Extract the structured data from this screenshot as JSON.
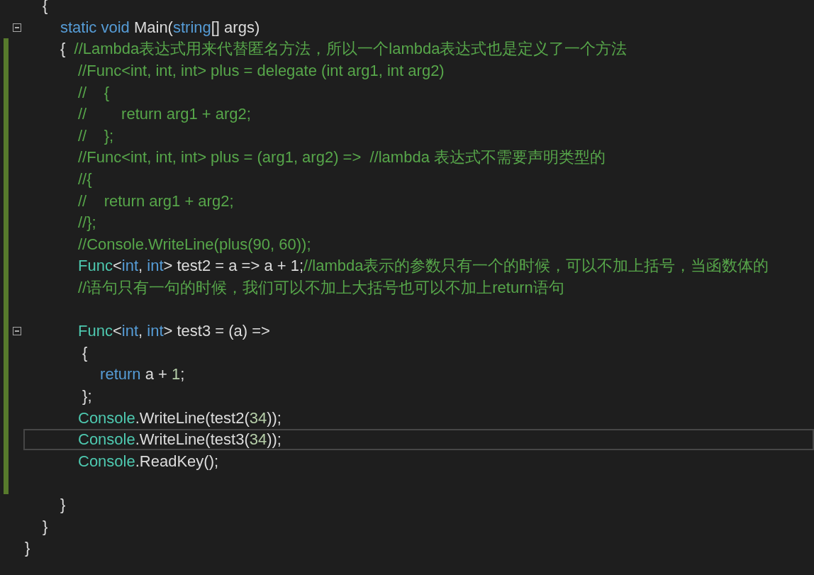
{
  "editor": {
    "lines": [
      {
        "changed": false,
        "tokens": [
          {
            "kind": "plain",
            "text": "\t{"
          }
        ]
      },
      {
        "changed": false,
        "expanded": true,
        "tokens": [
          {
            "kind": "keyword",
            "text": "\t\tstatic void "
          },
          {
            "kind": "plain",
            "text": "Main("
          },
          {
            "kind": "keyword",
            "text": "string"
          },
          {
            "kind": "plain",
            "text": "[] args)"
          }
        ]
      },
      {
        "changed": true,
        "tokens": [
          {
            "kind": "plain",
            "text": "\t\t{  "
          },
          {
            "kind": "comment",
            "text": "//Lambda表达式用来代替匿名方法，所以一个lambda表达式也是定义了一个方法"
          }
        ]
      },
      {
        "changed": true,
        "tokens": [
          {
            "kind": "comment",
            "text": "\t\t\t//Func<int, int, int> plus = delegate (int arg1, int arg2)"
          }
        ]
      },
      {
        "changed": true,
        "tokens": [
          {
            "kind": "comment",
            "text": "\t\t\t//    {"
          }
        ]
      },
      {
        "changed": true,
        "tokens": [
          {
            "kind": "comment",
            "text": "\t\t\t//        return arg1 + arg2;"
          }
        ]
      },
      {
        "changed": true,
        "tokens": [
          {
            "kind": "comment",
            "text": "\t\t\t//    };"
          }
        ]
      },
      {
        "changed": true,
        "tokens": [
          {
            "kind": "comment",
            "text": "\t\t\t//Func<int, int, int> plus = (arg1, arg2) =>  //lambda 表达式不需要声明类型的"
          }
        ]
      },
      {
        "changed": true,
        "tokens": [
          {
            "kind": "comment",
            "text": "\t\t\t//{"
          }
        ]
      },
      {
        "changed": true,
        "tokens": [
          {
            "kind": "comment",
            "text": "\t\t\t//    return arg1 + arg2;"
          }
        ]
      },
      {
        "changed": true,
        "tokens": [
          {
            "kind": "comment",
            "text": "\t\t\t//};"
          }
        ]
      },
      {
        "changed": true,
        "tokens": [
          {
            "kind": "comment",
            "text": "\t\t\t//Console.WriteLine(plus(90, 60));"
          }
        ]
      },
      {
        "changed": true,
        "tokens": [
          {
            "kind": "type",
            "text": "\t\t\tFunc"
          },
          {
            "kind": "plain",
            "text": "<"
          },
          {
            "kind": "keyword",
            "text": "int"
          },
          {
            "kind": "plain",
            "text": ", "
          },
          {
            "kind": "keyword",
            "text": "int"
          },
          {
            "kind": "plain",
            "text": "> test2 = a => a + 1;"
          },
          {
            "kind": "comment",
            "text": "//lambda表示的参数只有一个的时候，可以不加上括号，当函数体的"
          }
        ]
      },
      {
        "changed": true,
        "tokens": [
          {
            "kind": "comment",
            "text": "\t\t\t//语句只有一句的时候，我们可以不加上大括号也可以不加上return语句"
          }
        ]
      },
      {
        "changed": true
      },
      {
        "changed": true,
        "expanded": true,
        "tokens": [
          {
            "kind": "type",
            "text": "\t\t\tFunc"
          },
          {
            "kind": "plain",
            "text": "<"
          },
          {
            "kind": "keyword",
            "text": "int"
          },
          {
            "kind": "plain",
            "text": ", "
          },
          {
            "kind": "keyword",
            "text": "int"
          },
          {
            "kind": "plain",
            "text": "> test3 = (a) =>"
          }
        ]
      },
      {
        "changed": true,
        "tokens": [
          {
            "kind": "plain",
            "text": "\t\t\t {"
          }
        ]
      },
      {
        "changed": true,
        "tokens": [
          {
            "kind": "keyword",
            "text": "\t\t\t\t return "
          },
          {
            "kind": "plain",
            "text": "a + "
          },
          {
            "kind": "number",
            "text": "1"
          },
          {
            "kind": "plain",
            "text": ";"
          }
        ]
      },
      {
        "changed": true,
        "tokens": [
          {
            "kind": "plain",
            "text": "\t\t\t };"
          }
        ]
      },
      {
        "changed": true,
        "tokens": [
          {
            "kind": "type",
            "text": "\t\t\tConsole"
          },
          {
            "kind": "plain",
            "text": ".WriteLine(test2("
          },
          {
            "kind": "number",
            "text": "34"
          },
          {
            "kind": "plain",
            "text": "));"
          }
        ]
      },
      {
        "changed": true,
        "current": true,
        "tokens": [
          {
            "kind": "type",
            "text": "\t\t\tConsole"
          },
          {
            "kind": "plain",
            "text": ".WriteLine(test3("
          },
          {
            "kind": "number",
            "text": "34"
          },
          {
            "kind": "plain",
            "text": "));"
          }
        ]
      },
      {
        "changed": true,
        "tokens": [
          {
            "kind": "type",
            "text": "\t\t\tConsole"
          },
          {
            "kind": "plain",
            "text": ".ReadKey();"
          }
        ]
      },
      {
        "changed": true
      },
      {
        "changed": false,
        "tokens": [
          {
            "kind": "plain",
            "text": "\t\t}"
          }
        ]
      },
      {
        "changed": false,
        "tokens": [
          {
            "kind": "plain",
            "text": "\t}"
          }
        ]
      },
      {
        "changed": false,
        "tokens": [
          {
            "kind": "plain",
            "text": "}"
          }
        ]
      }
    ]
  }
}
